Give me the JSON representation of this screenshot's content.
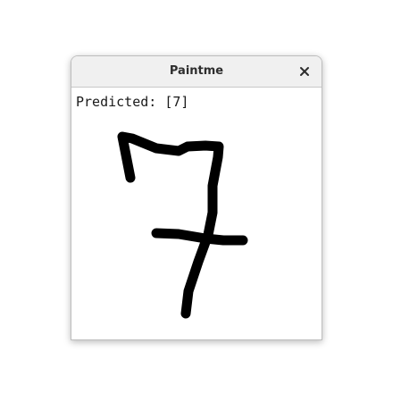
{
  "window": {
    "title": "Paintme",
    "close_icon": "close-icon"
  },
  "canvas": {
    "prediction_label": "Predicted: [7]",
    "drawn_digit": "7",
    "stroke_color": "#000000",
    "background_color": "#ffffff"
  }
}
